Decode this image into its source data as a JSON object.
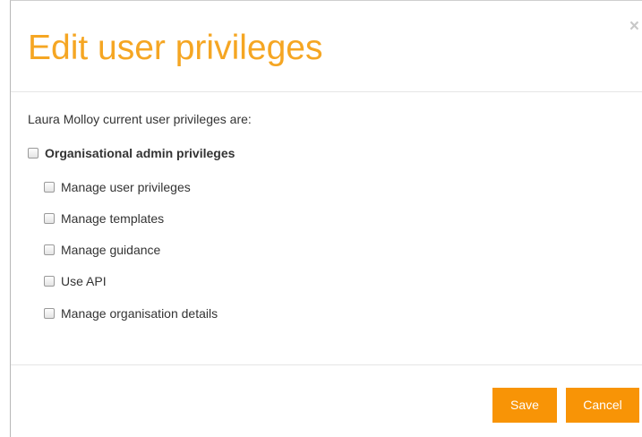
{
  "dialog": {
    "title": "Edit user privileges",
    "close_label": "×",
    "intro": "Laura Molloy current user privileges are:"
  },
  "privileges": {
    "group_label": "Organisational admin privileges",
    "group_checked": false,
    "items": [
      {
        "label": "Manage user privileges",
        "checked": false
      },
      {
        "label": "Manage templates",
        "checked": false
      },
      {
        "label": "Manage guidance",
        "checked": false
      },
      {
        "label": "Use API",
        "checked": false
      },
      {
        "label": "Manage organisation details",
        "checked": false
      }
    ]
  },
  "footer": {
    "save_label": "Save",
    "cancel_label": "Cancel"
  },
  "colors": {
    "accent": "#f5a623",
    "button": "#f89406"
  }
}
